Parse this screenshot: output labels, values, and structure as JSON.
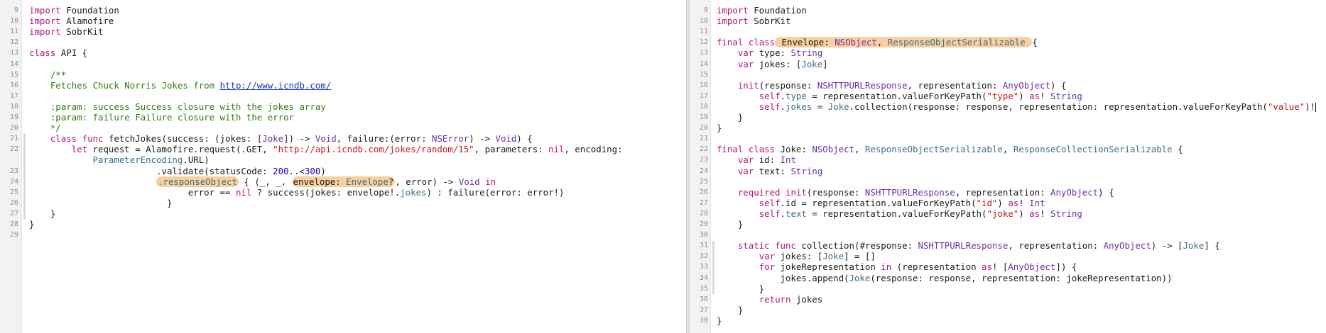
{
  "left": {
    "lines": [
      {
        "n": "9",
        "html": "<span class=\"kw\">import</span> Foundation"
      },
      {
        "n": "10",
        "html": "<span class=\"kw\">import</span> Alamofire"
      },
      {
        "n": "11",
        "html": "<span class=\"kw\">import</span> SobrKit"
      },
      {
        "n": "12",
        "html": ""
      },
      {
        "n": "13",
        "html": "<span class=\"kw\">class</span> API {"
      },
      {
        "n": "14",
        "html": ""
      },
      {
        "n": "15",
        "html": "    <span class=\"cm\">/**</span>"
      },
      {
        "n": "16",
        "html": "    <span class=\"cm\">Fetches Chuck Norris Jokes from </span><span class=\"link\">http://www.icndb.com/</span>"
      },
      {
        "n": "17",
        "html": ""
      },
      {
        "n": "18",
        "html": "    <span class=\"cm\">:param: success Success closure with the jokes array</span>"
      },
      {
        "n": "19",
        "html": "    <span class=\"cm\">:param: failure Failure closure with the error</span>"
      },
      {
        "n": "20",
        "html": "    <span class=\"cm\">*/</span>"
      },
      {
        "n": "21",
        "html": "    <span class=\"kw\">class</span> <span class=\"kw\">func</span> fetchJokes(success: (jokes: [<span class=\"ty\">Joke</span>]) -> <span class=\"ty\">Void</span>, failure:(error: <span class=\"ty\">NSError</span>) -> <span class=\"ty\">Void</span>) {"
      },
      {
        "n": "22",
        "html": "        <span class=\"kw\">let</span> request = Alamofire.request(.GET, <span class=\"str\">\"http://api.icndb.com/jokes/random/15\"</span>, parameters: <span class=\"kw\">nil</span>, encoding:"
      },
      {
        "n": "",
        "html": "            <span class=\"tp\">ParameterEncoding</span>.URL)"
      },
      {
        "n": "23",
        "html": "                        .validate(statusCode: <span class=\"num\">200</span>..&lt;<span class=\"num\">300</span>)"
      },
      {
        "n": "24",
        "html": "                        <span class=\"hl\"><span class=\"tp\">.responseObject</span></span> { (_, _, <span class=\"hl\">envelope: <span class=\"tp\">Envelope</span>?</span>, error) -> <span class=\"ty\">Void</span> <span class=\"kw\">in</span>"
      },
      {
        "n": "25",
        "html": "                              error == <span class=\"kw\">nil</span> ? success(jokes: envelope!.<span class=\"tp\">jokes</span>) : failure(error: error!)"
      },
      {
        "n": "26",
        "html": "                          }"
      },
      {
        "n": "27",
        "html": "    }"
      },
      {
        "n": "28",
        "html": "}"
      },
      {
        "n": "29",
        "html": ""
      }
    ]
  },
  "right": {
    "lines": [
      {
        "n": "9",
        "html": "<span class=\"kw\">import</span> Foundation"
      },
      {
        "n": "10",
        "html": "<span class=\"kw\">import</span> SobrKit"
      },
      {
        "n": "11",
        "html": ""
      },
      {
        "n": "12",
        "html": "<span class=\"kw\">final</span> <span class=\"kw\">class</span><span class=\"hl\"> Envelope: <span class=\"ty\">NSObject</span>, <span class=\"tp\">ResponseObjectSerializable</span> </span>{"
      },
      {
        "n": "13",
        "html": "    <span class=\"kw\">var</span> type: <span class=\"ty\">String</span>"
      },
      {
        "n": "14",
        "html": "    <span class=\"kw\">var</span> jokes: [<span class=\"tp\">Joke</span>]"
      },
      {
        "n": "15",
        "html": ""
      },
      {
        "n": "16",
        "html": "    <span class=\"kw\">init</span>(response: <span class=\"ty\">NSHTTPURLResponse</span>, representation: <span class=\"ty\">AnyObject</span>) {"
      },
      {
        "n": "17",
        "html": "        <span class=\"kw\">self</span>.<span class=\"tp\">type</span> = representation.valueForKeyPath(<span class=\"str\">\"type\"</span>) <span class=\"kw\">as</span>! <span class=\"ty\">String</span>"
      },
      {
        "n": "18",
        "html": "        <span class=\"kw\">self</span>.<span class=\"tp\">jokes</span> = <span class=\"tp\">Joke</span>.collection(response: response, representation: representation.valueForKeyPath(<span class=\"str\">\"value\"</span>)!<span class=\"cursor\"></span>"
      },
      {
        "n": "19",
        "html": "    }"
      },
      {
        "n": "20",
        "html": "}"
      },
      {
        "n": "21",
        "html": ""
      },
      {
        "n": "22",
        "html": "<span class=\"kw\">final</span> <span class=\"kw\">class</span> Joke: <span class=\"ty\">NSObject</span>, <span class=\"tp\">ResponseObjectSerializable</span>, <span class=\"tp\">ResponseCollectionSerializable</span> {"
      },
      {
        "n": "23",
        "html": "    <span class=\"kw\">var</span> id: <span class=\"ty\">Int</span>"
      },
      {
        "n": "24",
        "html": "    <span class=\"kw\">var</span> text: <span class=\"ty\">String</span>"
      },
      {
        "n": "25",
        "html": ""
      },
      {
        "n": "26",
        "html": "    <span class=\"kw\">required</span> <span class=\"kw\">init</span>(response: <span class=\"ty\">NSHTTPURLResponse</span>, representation: <span class=\"ty\">AnyObject</span>) {"
      },
      {
        "n": "27",
        "html": "        <span class=\"kw\">self</span>.id = representation.valueForKeyPath(<span class=\"str\">\"id\"</span>) <span class=\"kw\">as</span>! <span class=\"ty\">Int</span>"
      },
      {
        "n": "28",
        "html": "        <span class=\"kw\">self</span>.<span class=\"tp\">text</span> = representation.valueForKeyPath(<span class=\"str\">\"joke\"</span>) <span class=\"kw\">as</span>! <span class=\"ty\">String</span>"
      },
      {
        "n": "29",
        "html": "    }"
      },
      {
        "n": "30",
        "html": ""
      },
      {
        "n": "31",
        "html": "    <span class=\"kw\">static</span> <span class=\"kw\">func</span> collection(#response: <span class=\"ty\">NSHTTPURLResponse</span>, representation: <span class=\"ty\">AnyObject</span>) -> [<span class=\"tp\">Joke</span>] {"
      },
      {
        "n": "32",
        "html": "        <span class=\"kw\">var</span> jokes: [<span class=\"tp\">Joke</span>] = []"
      },
      {
        "n": "33",
        "html": "        <span class=\"kw\">for</span> jokeRepresentation <span class=\"kw\">in</span> (representation <span class=\"kw\">as</span>! [<span class=\"ty\">AnyObject</span>]) {"
      },
      {
        "n": "34",
        "html": "            jokes.append(<span class=\"tp\">Joke</span>(response: response, representation: jokeRepresentation))"
      },
      {
        "n": "35",
        "html": "        }"
      },
      {
        "n": "36",
        "html": "        <span class=\"kw\">return</span> jokes"
      },
      {
        "n": "37",
        "html": "    }"
      },
      {
        "n": "38",
        "html": "}"
      }
    ]
  }
}
